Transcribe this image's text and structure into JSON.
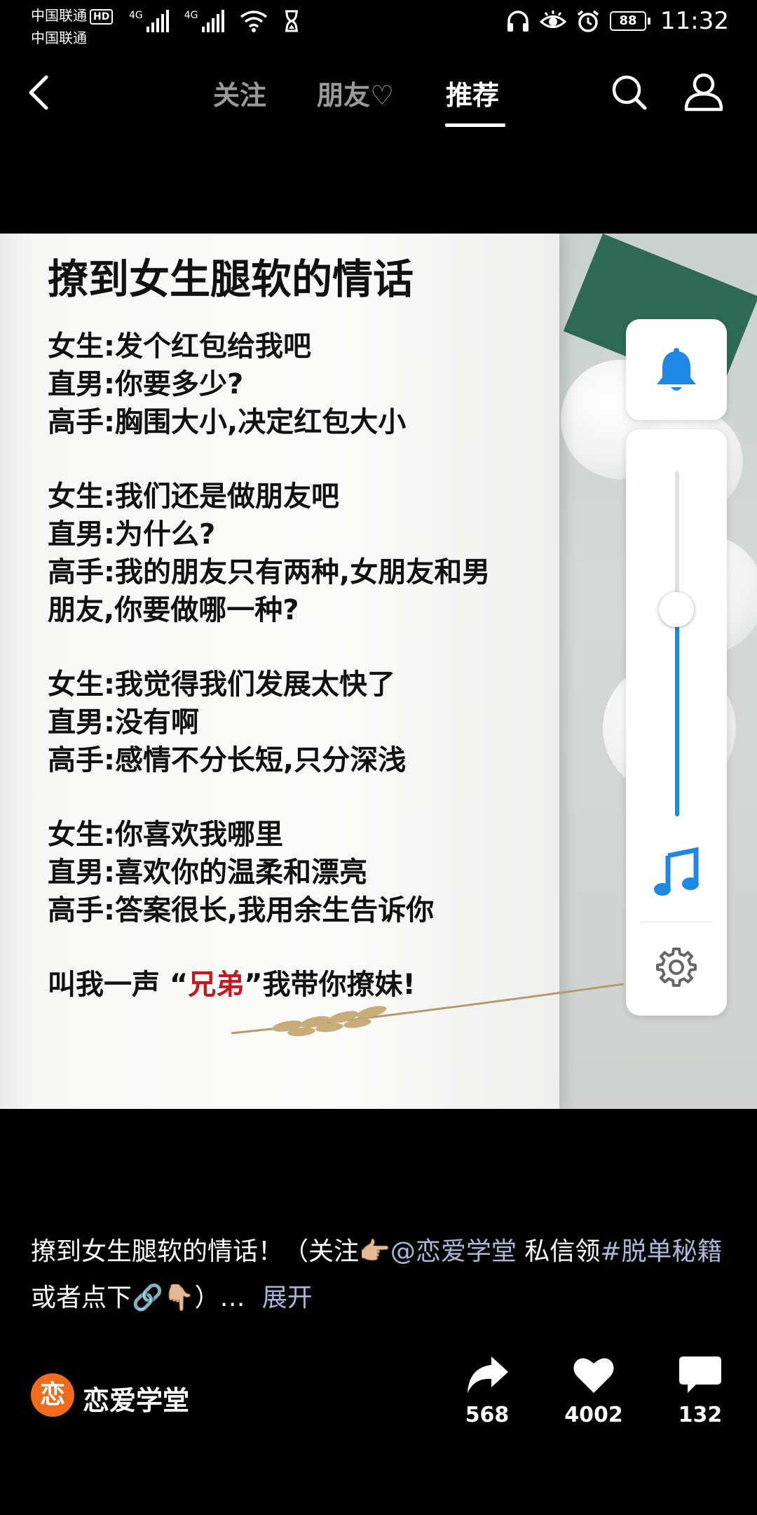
{
  "status_bar": {
    "carrier1": "中国联通",
    "hd": "HD",
    "carrier2": "中国联通",
    "net1": "4G",
    "net2": "4G",
    "battery": "88",
    "time": "11:32"
  },
  "nav": {
    "tabs": [
      {
        "label": "关注",
        "active": false
      },
      {
        "label": "朋友♡",
        "active": false
      },
      {
        "label": "推荐",
        "active": true
      }
    ]
  },
  "video": {
    "title": "撩到女生腿软的情话",
    "stanzas": [
      [
        "女生:发个红包给我吧",
        "直男:你要多少?",
        "高手:胸围大小,决定红包大小"
      ],
      [
        "女生:我们还是做朋友吧",
        "直男:为什么?",
        "高手:我的朋友只有两种,女朋友和男",
        "朋友,你要做哪一种?"
      ],
      [
        "女生:我觉得我们发展太快了",
        "直男:没有啊",
        "高手:感情不分长短,只分深浅"
      ],
      [
        "女生:你喜欢我哪里",
        "直男:喜欢你的温柔和漂亮",
        "高手:答案很长,我用余生告诉你"
      ]
    ],
    "closing_pre": "叫我一声 “",
    "closing_red": "兄弟",
    "closing_post": "”我带你撩妹!"
  },
  "control_panel": {
    "volume_level": 0.6,
    "accent_color": "#1e88e5",
    "icons": [
      "bell-icon",
      "music-note-icon",
      "gear-icon"
    ]
  },
  "caption": {
    "text1": "撩到女生腿软的情话！（关注",
    "emoji1": "👉🏼",
    "mention": "@恋爱学堂",
    "text2": " 私信领",
    "tag": "#脱单秘籍",
    "text3": " 或者点下",
    "emoji2": "🔗👇🏼",
    "text4": "）…",
    "more": "展开"
  },
  "author": {
    "avatar_char": "恋",
    "name": "恋爱学堂"
  },
  "actions": {
    "share_count": "568",
    "like_count": "4002",
    "comment_count": "132"
  }
}
